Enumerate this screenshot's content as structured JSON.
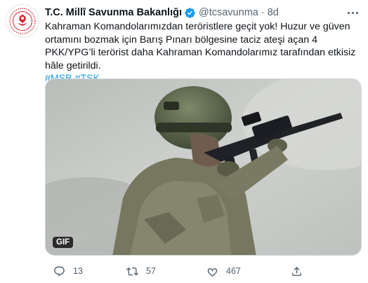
{
  "account": {
    "name": "T.C. Millî Savunma Bakanlığı",
    "handle": "@tcsavunma",
    "separator": "·",
    "time": "8d"
  },
  "tweet": {
    "text": "Kahraman Komandolarımızdan teröristlere geçit yok! Huzur ve güven ortamını bozmak için Barış Pınarı bölgesine taciz ateşi açan 4 PKK/YPG’li terörist daha Kahraman Komandolarımız tarafından etkisiz hâle getirildi.",
    "hashtags": [
      "#MSB",
      "#TSK"
    ]
  },
  "media": {
    "badge": "GIF"
  },
  "actions": {
    "reply_count": "13",
    "retweet_count": "57",
    "like_count": "467"
  },
  "icons": {
    "verified": "verified-badge-icon",
    "more": "more-options-icon",
    "reply": "reply-icon",
    "retweet": "retweet-icon",
    "like": "heart-icon",
    "share": "share-icon"
  },
  "colors": {
    "accent": "#1d9bf0",
    "secondary_text": "#536471",
    "logo_red": "#d9212c"
  }
}
